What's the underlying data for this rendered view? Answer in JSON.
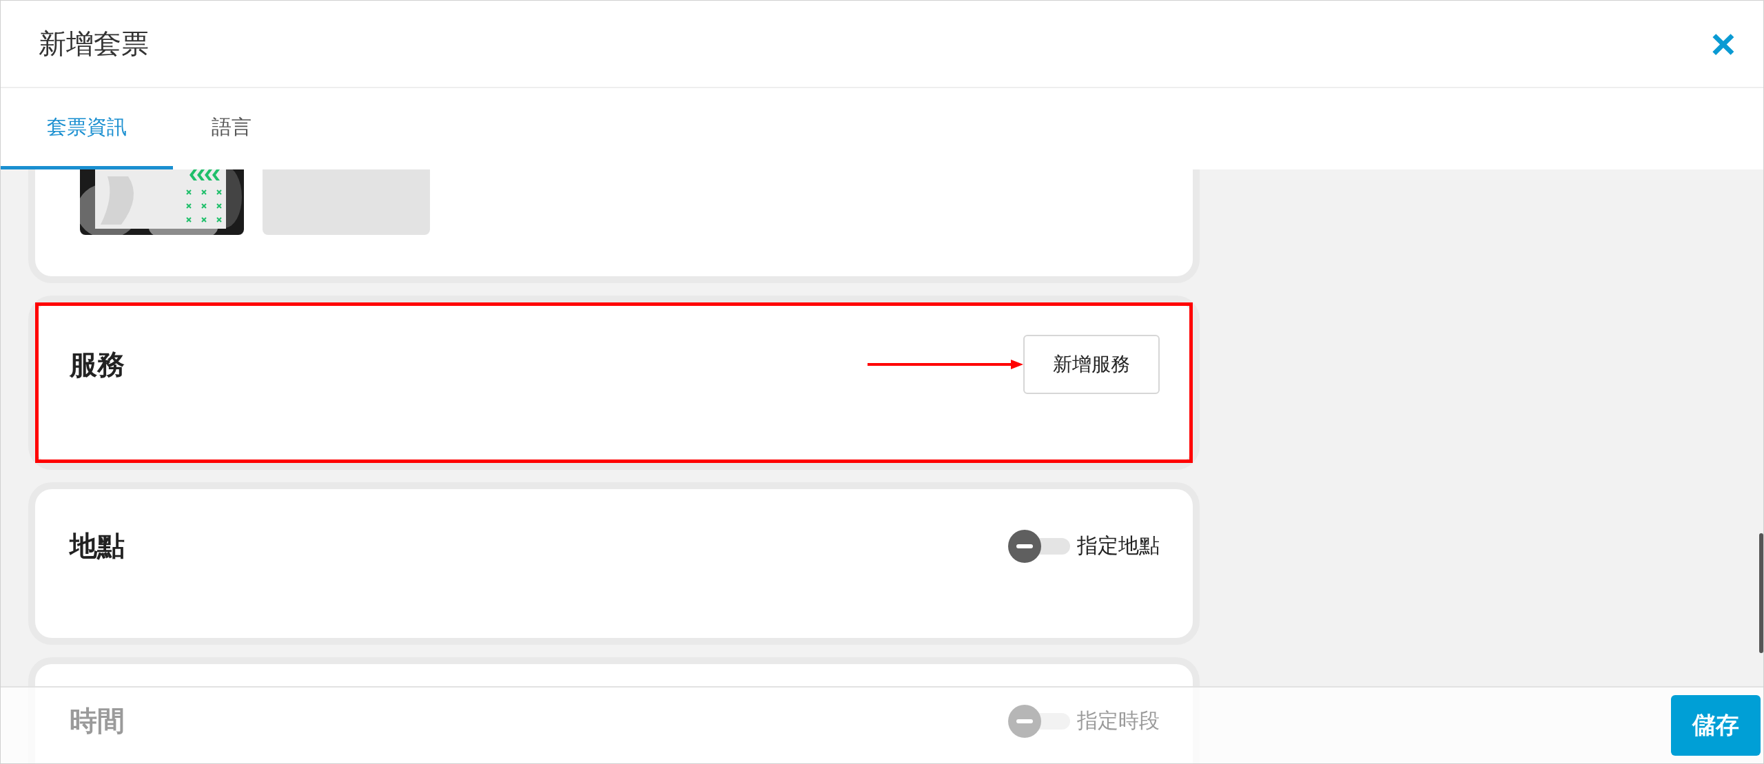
{
  "dialog": {
    "title": "新增套票",
    "close_icon": "×"
  },
  "tabs": [
    {
      "label": "套票資訊",
      "selected": true
    },
    {
      "label": "語言",
      "selected": false
    }
  ],
  "sections": [
    {
      "kind": "media",
      "images": [
        {
          "kind": "picture"
        },
        {
          "kind": "empty"
        }
      ]
    },
    {
      "kind": "button",
      "title": "服務",
      "button": "新增服務",
      "highlighted": true
    },
    {
      "kind": "toggle",
      "title": "地點",
      "toggle_label": "指定地點",
      "on": false,
      "faded": false
    },
    {
      "kind": "toggle",
      "title": "時間",
      "toggle_label": "指定時段",
      "on": false,
      "faded": true
    }
  ],
  "footer": {
    "save_button": "儲存"
  }
}
